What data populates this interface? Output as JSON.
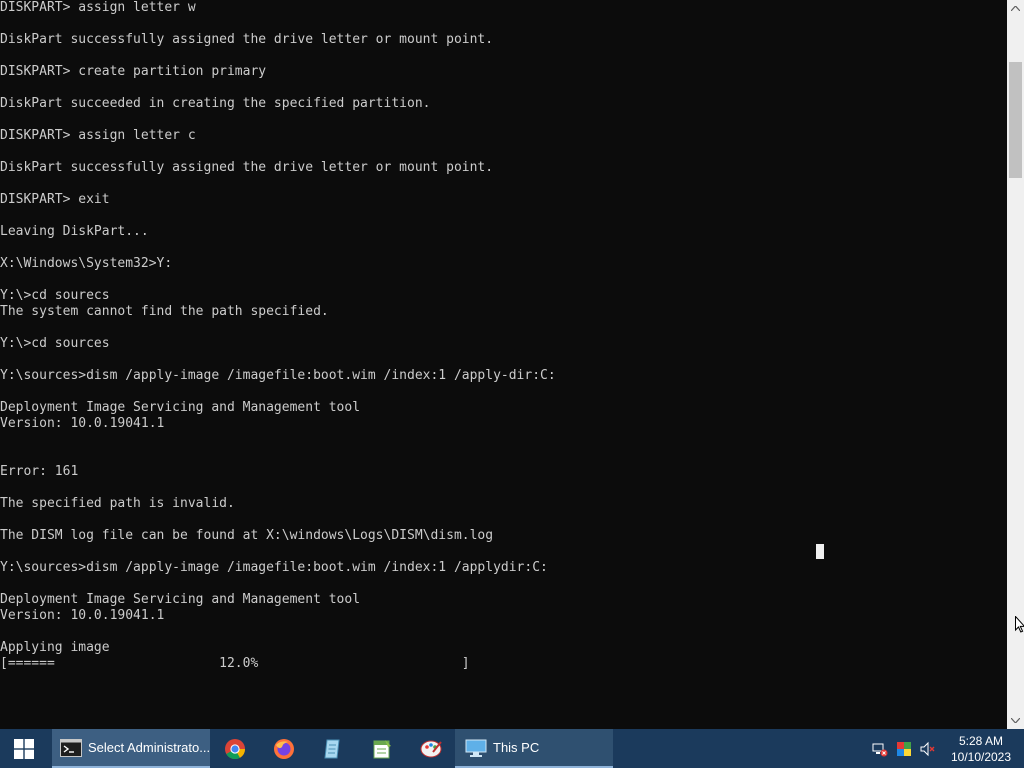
{
  "console": {
    "lines": [
      "DISKPART> assign letter w",
      "",
      "DiskPart successfully assigned the drive letter or mount point.",
      "",
      "DISKPART> create partition primary",
      "",
      "DiskPart succeeded in creating the specified partition.",
      "",
      "DISKPART> assign letter c",
      "",
      "DiskPart successfully assigned the drive letter or mount point.",
      "",
      "DISKPART> exit",
      "",
      "Leaving DiskPart...",
      "",
      "X:\\Windows\\System32>Y:",
      "",
      "Y:\\>cd sourecs",
      "The system cannot find the path specified.",
      "",
      "Y:\\>cd sources",
      "",
      "Y:\\sources>dism /apply-image /imagefile:boot.wim /index:1 /apply-dir:C:",
      "",
      "Deployment Image Servicing and Management tool",
      "Version: 10.0.19041.1",
      "",
      "",
      "Error: 161",
      "",
      "The specified path is invalid.",
      "",
      "The DISM log file can be found at X:\\windows\\Logs\\DISM\\dism.log",
      "",
      "Y:\\sources>dism /apply-image /imagefile:boot.wim /index:1 /applydir:C:",
      "",
      "Deployment Image Servicing and Management tool",
      "Version: 10.0.19041.1",
      "",
      "Applying image",
      "[======                     12.0%                          ]"
    ]
  },
  "taskbar": {
    "start_icon": "windows-logo-icon",
    "active_task_label": "Select Administrato...",
    "pinned": [
      "chrome-icon",
      "firefox-icon",
      "notepad-icon",
      "notepadpp-icon",
      "paint-icon"
    ],
    "explorer_task_label": "This PC",
    "tray_icons": [
      "network-disconnected-icon",
      "color-app-icon",
      "volume-muted-icon"
    ],
    "time": "5:28 AM",
    "date": "10/10/2023"
  },
  "colors": {
    "console_bg": "#0c0c0c",
    "console_text": "#cccccc",
    "taskbar_bg": "#1b3a5c",
    "taskbar_active": "#3d5f82"
  }
}
